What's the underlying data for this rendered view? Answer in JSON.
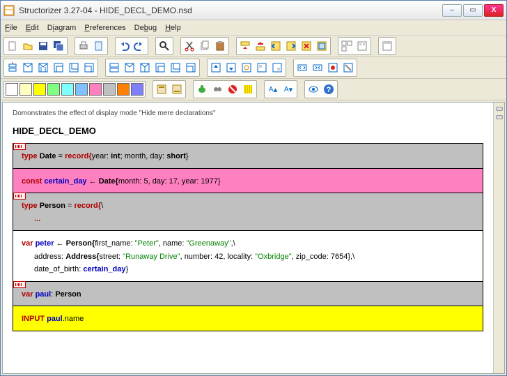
{
  "window": {
    "title": "Structorizer 3.27-04 - HIDE_DECL_DEMO.nsd",
    "min": "–",
    "max": "▭",
    "close": "X"
  },
  "menu": {
    "file": "File",
    "edit": "Edit",
    "diagram": "Diagram",
    "prefs": "Preferences",
    "debug": "Debug",
    "help": "Help"
  },
  "desc": "Domonstrates the effect of display mode \"Hide mere declarations\"",
  "prog": "HIDE_DECL_DEMO",
  "blocks": {
    "b1_pre": "type ",
    "b1_name": "Date",
    "b1_mid": " = ",
    "b1_rec": "record{",
    "b1_body": "year: ",
    "b1_int": "int",
    "b1_body2": "; month, day: ",
    "b1_short": "short",
    "b1_end": "}",
    "b2_pre": "const ",
    "b2_name": "certain_day",
    "b2_arrow": " ← ",
    "b2_ty": "Date{",
    "b2_body": "month: 5, day: 17, year: 1977}",
    "b3_pre": "type ",
    "b3_name": "Person",
    "b3_mid": " = ",
    "b3_rec": "record{",
    "b3_cont": "\\",
    "b3_dots": "...",
    "b4_pre": "var ",
    "b4_name": "peter",
    "b4_arrow": " ← ",
    "b4_ty": "Person{",
    "b4_l1": "first_name: ",
    "b4_s1": "\"Peter\"",
    "b4_l2": ", name: ",
    "b4_s2": "\"Greenaway\"",
    "b4_l3": ",\\",
    "b4_addr": "address: ",
    "b4_aty": "Address{",
    "b4_al1": "street: ",
    "b4_as1": "\"Runaway Drive\"",
    "b4_al2": ", number: 42, locality: ",
    "b4_as2": "\"Oxbridge\"",
    "b4_al3": ", zip_code: 7654},\\",
    "b4_dob": "date_of_birth: ",
    "b4_dobv": "certain_day",
    "b4_end": "}",
    "b5_pre": "var ",
    "b5_name": "paul",
    "b5_ty": ": ",
    "b5_tyv": "Person",
    "b6_in": "INPUT ",
    "b6_name": "paul",
    "b6_tail": ".name"
  },
  "colors": [
    "#ffffff",
    "#ffff80",
    "#ffff00",
    "#80ff80",
    "#80ffff",
    "#0080ff",
    "#ff80c0",
    "#c0c0c0",
    "#ff8000",
    "#8080ff"
  ]
}
